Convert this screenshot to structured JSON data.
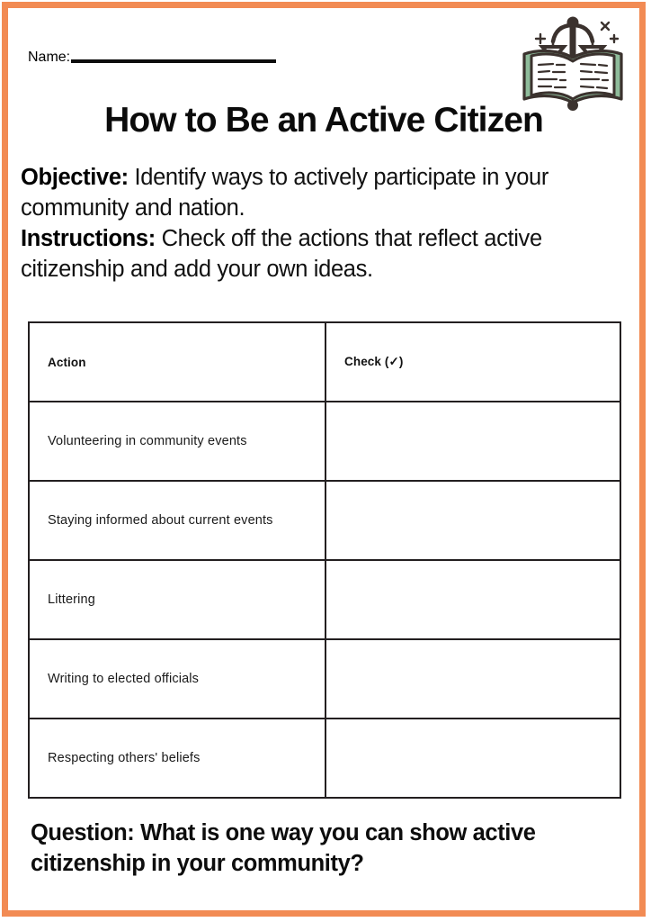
{
  "page": {
    "frame_color": "#F28B54",
    "background": "#ffffff"
  },
  "header": {
    "name_label": "Name:",
    "name_value": "",
    "icon_name": "law-book-scales-icon",
    "icon_book_color": "#8FBC9B",
    "icon_ink_color": "#3B322E"
  },
  "title": "How to Be an Active Citizen",
  "intro": {
    "objective_lead": "Objective:",
    "objective_text": " Identify ways to actively participate in your community and nation.",
    "instructions_lead": "Instructions:",
    "instructions_text": " Check off the actions that reflect active citizenship and add your own ideas."
  },
  "table": {
    "headers": [
      "Action",
      "Check (✓)"
    ],
    "header_action": "Action",
    "header_check": "Check (✓)",
    "rows": [
      {
        "action": "Volunteering in community events",
        "check": ""
      },
      {
        "action": "Staying informed about current events",
        "check": ""
      },
      {
        "action": "Littering",
        "check": ""
      },
      {
        "action": "Writing to elected officials",
        "check": ""
      },
      {
        "action": "Respecting others' beliefs",
        "check": ""
      }
    ]
  },
  "question": {
    "text": "Question: What is one way you can show active citizenship in your community?"
  }
}
